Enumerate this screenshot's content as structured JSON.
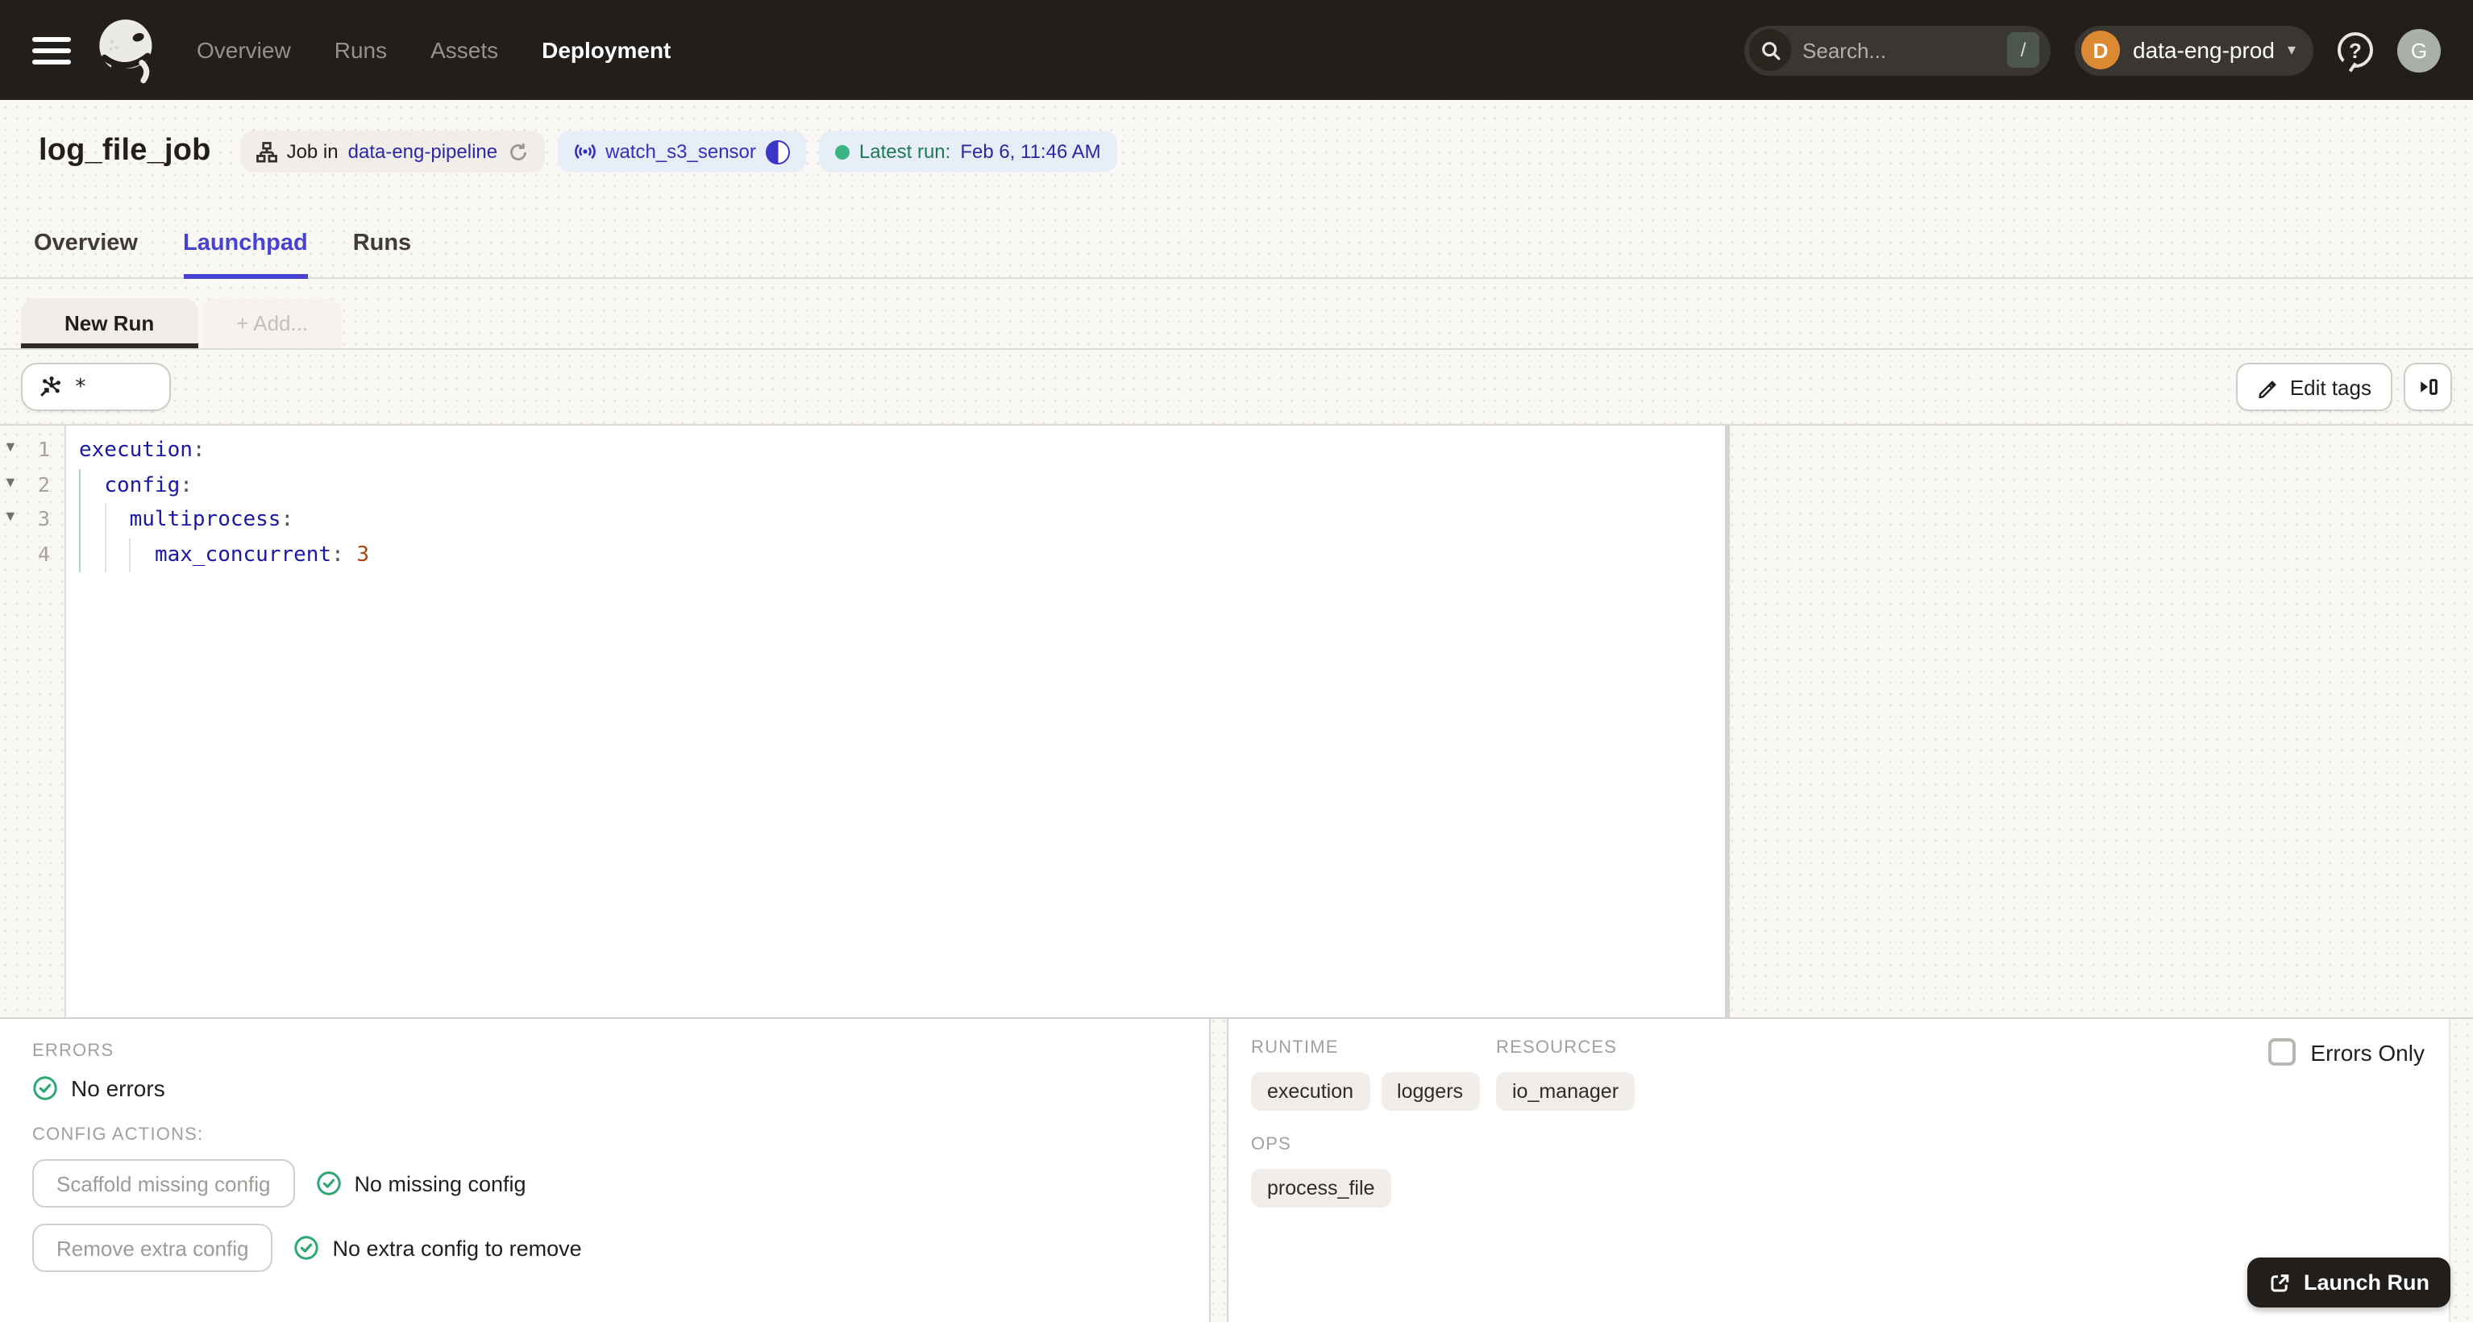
{
  "topnav": {
    "links": [
      {
        "label": "Overview"
      },
      {
        "label": "Runs"
      },
      {
        "label": "Assets"
      },
      {
        "label": "Deployment"
      }
    ],
    "search_placeholder": "Search...",
    "search_shortcut": "/",
    "workspace": {
      "initial": "D",
      "name": "data-eng-prod"
    },
    "help_glyph": "?",
    "avatar_initial": "G"
  },
  "title_bar": {
    "title": "log_file_job",
    "job_badge": {
      "prefix": "Job in",
      "link": "data-eng-pipeline"
    },
    "sensor_badge": {
      "name": "watch_s3_sensor"
    },
    "latest_run_badge": {
      "label": "Latest run:",
      "value": "Feb 6, 11:46 AM"
    }
  },
  "tabs": [
    {
      "label": "Overview"
    },
    {
      "label": "Launchpad"
    },
    {
      "label": "Runs"
    }
  ],
  "session_tabs": {
    "active": "New Run",
    "add": "+ Add..."
  },
  "toolbar": {
    "op_selection": "*",
    "edit_tags": "Edit tags"
  },
  "editor": {
    "lines": [
      {
        "num": "1",
        "prefix": "",
        "key": "execution",
        "colon": ":",
        "value": ""
      },
      {
        "num": "2",
        "prefix": "  ",
        "key": "config",
        "colon": ":",
        "value": ""
      },
      {
        "num": "3",
        "prefix": "    ",
        "key": "multiprocess",
        "colon": ":",
        "value": ""
      },
      {
        "num": "4",
        "prefix": "      ",
        "key": "max_concurrent",
        "colon": ":",
        "value": " 3"
      }
    ]
  },
  "bottom": {
    "errors_label": "ERRORS",
    "no_errors": "No errors",
    "config_actions_label": "CONFIG ACTIONS:",
    "actions": [
      {
        "button": "Scaffold missing config",
        "status": "No missing config"
      },
      {
        "button": "Remove extra config",
        "status": "No extra config to remove"
      }
    ],
    "right": {
      "runtime_label": "RUNTIME",
      "runtime_tags": [
        "execution",
        "loggers"
      ],
      "resources_label": "RESOURCES",
      "resources_tags": [
        "io_manager"
      ],
      "ops_label": "OPS",
      "ops_tags": [
        "process_file"
      ],
      "errors_only": "Errors Only",
      "launch_run": "Launch Run"
    }
  },
  "colors": {
    "nav_bg": "#221E1C",
    "accent_blue": "#4742D2",
    "link_navy": "#2B28A5",
    "green": "#2EA873",
    "yaml_key": "#1A18A4",
    "yaml_number": "#B04513",
    "workspace_avatar_orange": "#DB8A33"
  }
}
